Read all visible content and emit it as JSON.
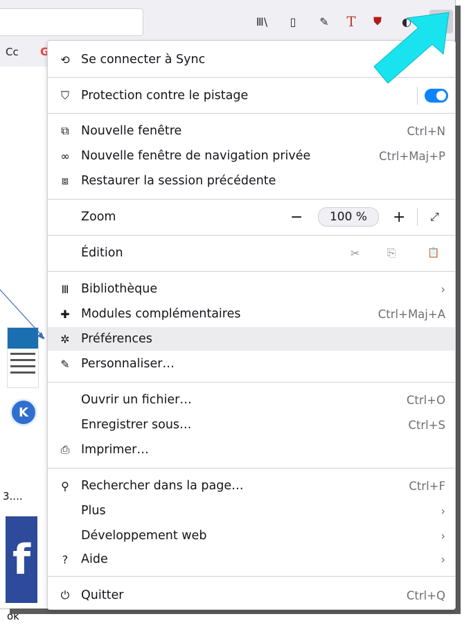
{
  "toolbar": {
    "icons": [
      "library-icon",
      "sidebar-icon",
      "extension-icon",
      "text-extension-icon",
      "ublock-icon",
      "extension-icon",
      "hamburger-menu-icon"
    ],
    "library_glyph": "Ⅲ\\",
    "sidebar_glyph": "▯",
    "ext1_glyph": "✎",
    "t_glyph": "T",
    "ublock_glyph": "⛊",
    "ext2_glyph": "◐",
    "menu_glyph": "☰"
  },
  "bookmarks": {
    "item_text": "Cc",
    "g_glyph": "G"
  },
  "side": {
    "label1": "3....",
    "label2": "ok",
    "k_glyph": "K",
    "fb_glyph": "f"
  },
  "menu": {
    "sync": {
      "label": "Se connecter à Sync",
      "icon": "sync-icon"
    },
    "tracking": {
      "label": "Protection contre le pistage",
      "icon": "shield-icon",
      "enabled": true
    },
    "new_window": {
      "label": "Nouvelle fenêtre",
      "shortcut": "Ctrl+N",
      "icon": "new-window-icon"
    },
    "private_window": {
      "label": "Nouvelle fenêtre de navigation privée",
      "shortcut": "Ctrl+Maj+P",
      "icon": "private-mask-icon"
    },
    "restore": {
      "label": "Restaurer la session précédente",
      "icon": "restore-session-icon"
    },
    "zoom": {
      "label": "Zoom",
      "minus": "−",
      "value": "100 %",
      "plus": "+",
      "fullscreen": "⤢"
    },
    "edit": {
      "label": "Édition",
      "cut": "✂",
      "copy": "⎘",
      "paste": "📋"
    },
    "library": {
      "label": "Bibliothèque",
      "chevron": "›",
      "icon": "library-icon"
    },
    "addons": {
      "label": "Modules complémentaires",
      "shortcut": "Ctrl+Maj+A",
      "icon": "puzzle-icon"
    },
    "preferences": {
      "label": "Préférences",
      "icon": "gear-icon"
    },
    "customize": {
      "label": "Personnaliser…",
      "icon": "paintbrush-icon"
    },
    "open_file": {
      "label": "Ouvrir un fichier…",
      "shortcut": "Ctrl+O"
    },
    "save_as": {
      "label": "Enregistrer sous…",
      "shortcut": "Ctrl+S"
    },
    "print": {
      "label": "Imprimer…",
      "icon": "printer-icon"
    },
    "find": {
      "label": "Rechercher dans la page…",
      "shortcut": "Ctrl+F",
      "icon": "search-icon"
    },
    "more": {
      "label": "Plus",
      "chevron": "›"
    },
    "webdev": {
      "label": "Développement web",
      "chevron": "›"
    },
    "help": {
      "label": "Aide",
      "chevron": "›",
      "icon": "help-icon"
    },
    "quit": {
      "label": "Quitter",
      "shortcut": "Ctrl+Q",
      "icon": "power-icon"
    }
  },
  "colors": {
    "accent": "#0a84ff",
    "annotation_arrow": "#19e3ee",
    "pointer_line": "#3c6fb8"
  }
}
